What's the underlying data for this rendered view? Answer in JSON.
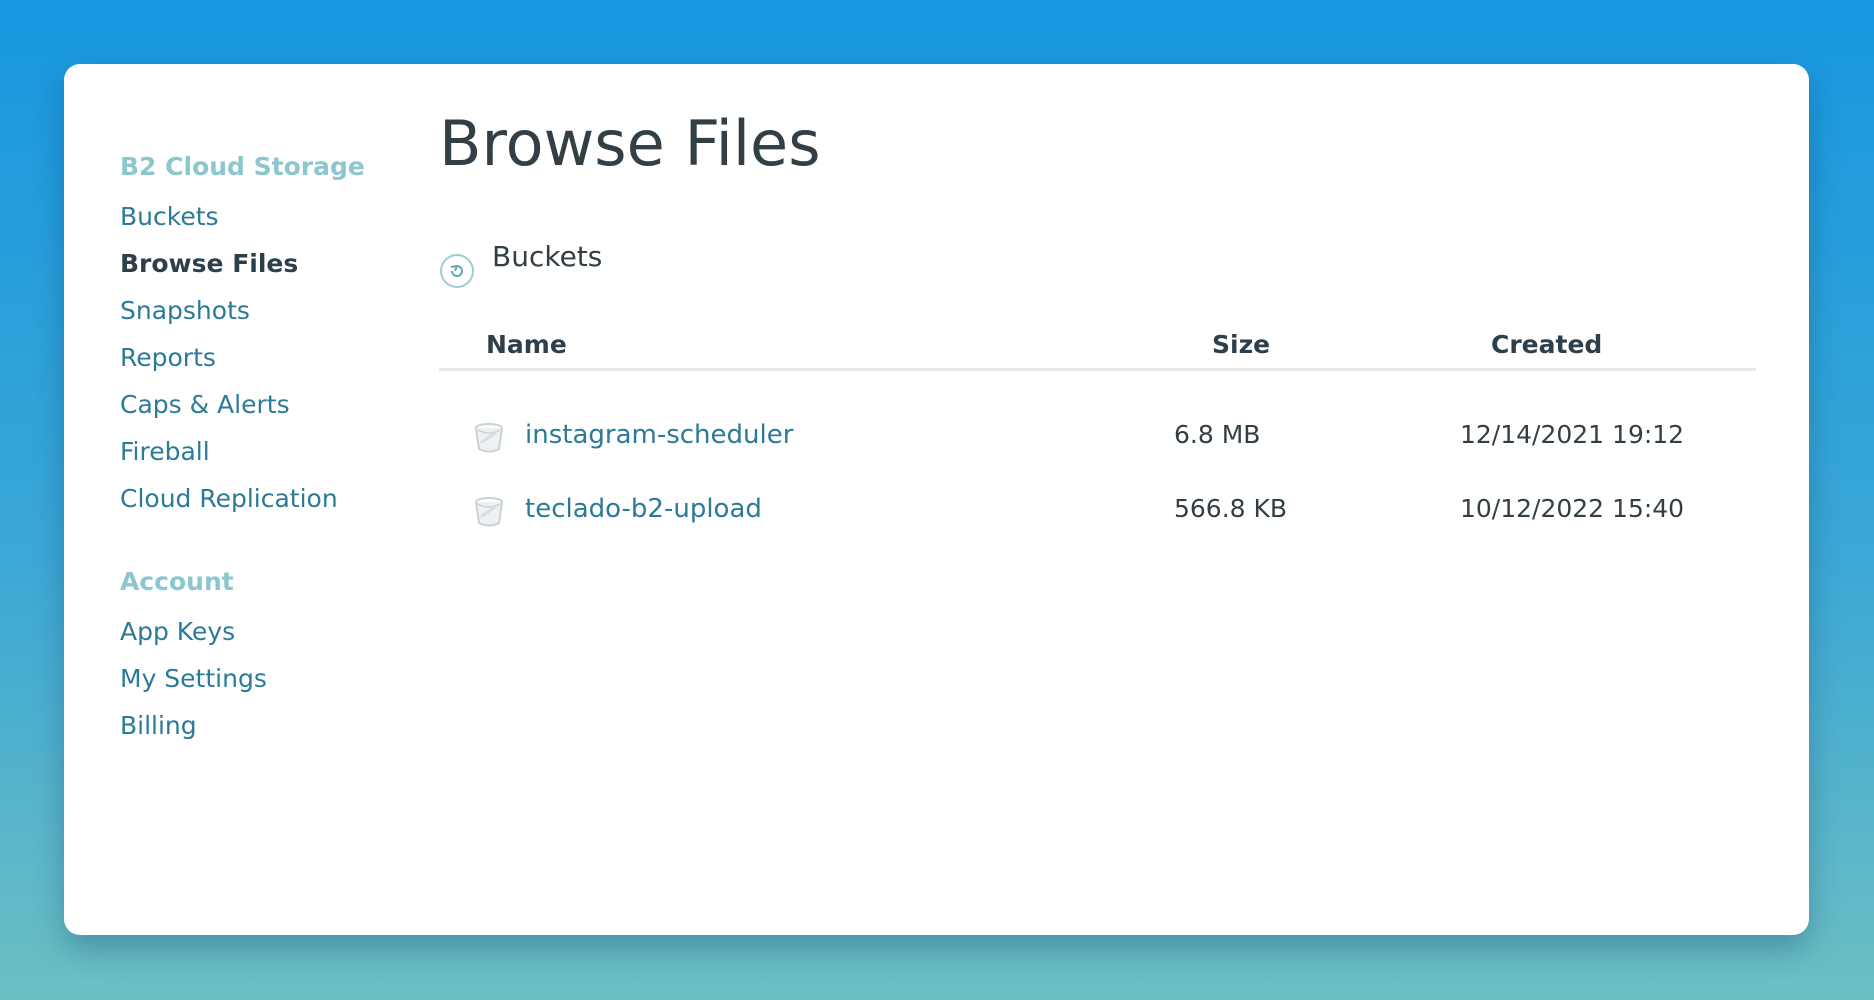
{
  "page": {
    "title": "Browse Files"
  },
  "sidebar": {
    "groups": [
      {
        "heading": "B2 Cloud Storage",
        "items": [
          {
            "label": "Buckets"
          },
          {
            "label": "Browse Files",
            "active": true
          },
          {
            "label": "Snapshots"
          },
          {
            "label": "Reports"
          },
          {
            "label": "Caps & Alerts"
          },
          {
            "label": "Fireball"
          },
          {
            "label": "Cloud Replication"
          }
        ]
      },
      {
        "heading": "Account",
        "items": [
          {
            "label": "App Keys"
          },
          {
            "label": "My Settings"
          },
          {
            "label": "Billing"
          }
        ]
      }
    ]
  },
  "main": {
    "refresh_icon": "refresh-icon",
    "section_label": "Buckets",
    "table": {
      "columns": [
        "Name",
        "Size",
        "Created"
      ],
      "rows": [
        {
          "icon": "bucket-icon",
          "name": "instagram-scheduler",
          "size": "6.8 MB",
          "created": "12/14/2021 19:12"
        },
        {
          "icon": "bucket-icon",
          "name": "teclado-b2-upload",
          "size": "566.8 KB",
          "created": "10/12/2022 15:40"
        }
      ]
    }
  },
  "colors": {
    "link": "#2b7a98",
    "heading": "#8cc6cf",
    "text": "#333f47",
    "background_top": "#1797e0",
    "background_bottom": "#6cbfc3"
  }
}
